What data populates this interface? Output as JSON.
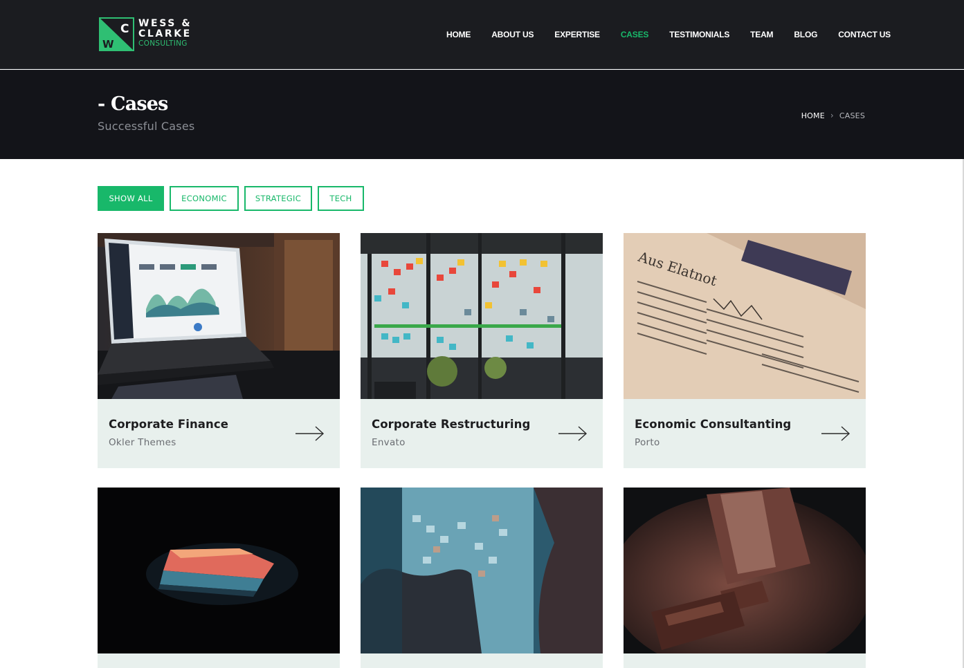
{
  "brand": {
    "mark_letters": [
      "C",
      "W"
    ],
    "line1": "WESS &",
    "line2": "CLARKE",
    "line3": "CONSULTING",
    "colors": {
      "green": "#2fbf73",
      "white": "#ffffff"
    }
  },
  "nav": {
    "items": [
      {
        "label": "HOME",
        "active": false
      },
      {
        "label": "ABOUT US",
        "active": false
      },
      {
        "label": "EXPERTISE",
        "active": false
      },
      {
        "label": "CASES",
        "active": true
      },
      {
        "label": "TESTIMONIALS",
        "active": false
      },
      {
        "label": "TEAM",
        "active": false
      },
      {
        "label": "BLOG",
        "active": false
      },
      {
        "label": "CONTACT US",
        "active": false
      }
    ]
  },
  "page_header": {
    "title": "- Cases",
    "subtitle": "Successful Cases",
    "breadcrumb": {
      "home": "HOME",
      "separator": "›",
      "current": "CASES"
    }
  },
  "filters": [
    {
      "label": "SHOW ALL",
      "active": true
    },
    {
      "label": "ECONOMIC",
      "active": false
    },
    {
      "label": "STRATEGIC",
      "active": false
    },
    {
      "label": "TECH",
      "active": false
    }
  ],
  "cases": [
    {
      "title": "Corporate Finance",
      "source": "Okler Themes",
      "image": "laptop-dashboard-photo"
    },
    {
      "title": "Corporate Restructuring",
      "source": "Envato",
      "image": "sticky-notes-glass-wall-photo"
    },
    {
      "title": "Economic Consultanting",
      "source": "Porto",
      "image": "financial-newspaper-photo"
    },
    {
      "title": "",
      "source": "",
      "image": "dark-laptop-glow-photo"
    },
    {
      "title": "",
      "source": "",
      "image": "planning-board-photo"
    },
    {
      "title": "",
      "source": "",
      "image": "gavel-photo"
    }
  ],
  "theme": {
    "accent": "#18b86a",
    "header_bg": "#1b1c20",
    "page_header_bg": "#131419",
    "card_bg": "#e8f0ed"
  }
}
